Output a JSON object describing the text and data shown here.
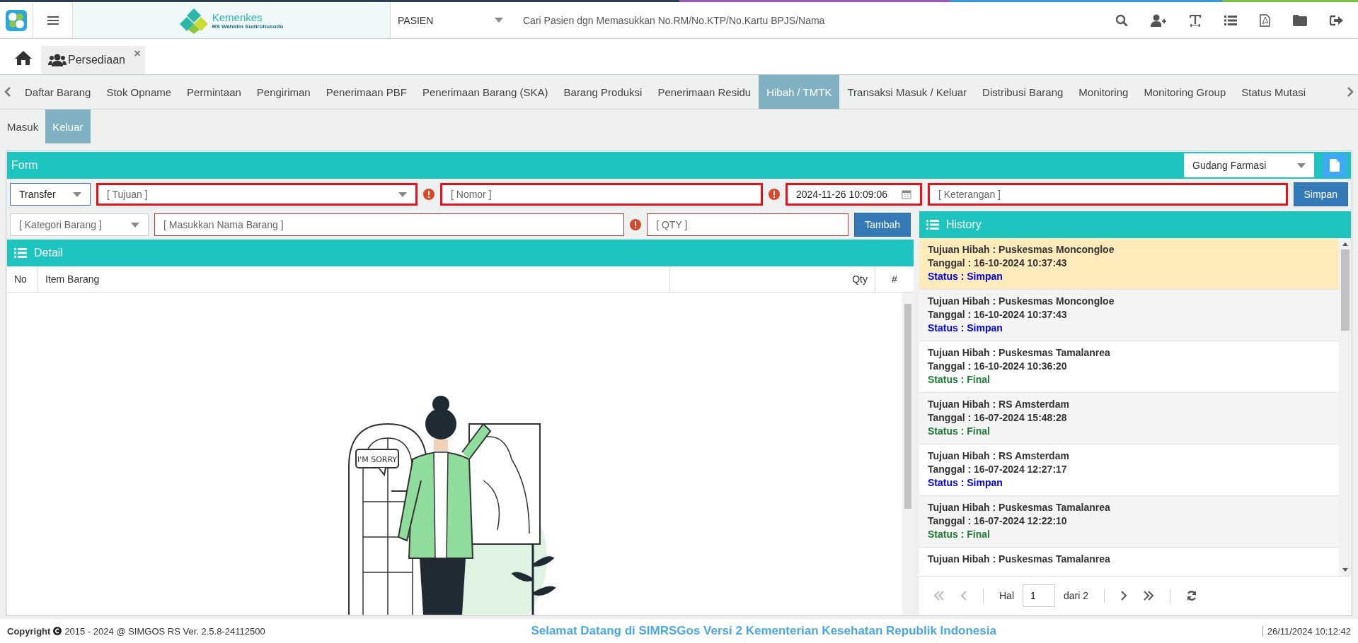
{
  "header": {
    "logo_title": "Kemenkes",
    "logo_subtitle": "RS Wahidin Sudirohusodo",
    "search_type": "PASIEN",
    "search_placeholder": "Cari Pasien dgn Memasukkan No.RM/No.KTP/No.Kartu BPJS/Nama"
  },
  "open_tab": {
    "label": "Persediaan",
    "close": "×"
  },
  "nav_tabs": [
    {
      "label": "Daftar Barang",
      "selected": false
    },
    {
      "label": "Stok Opname",
      "selected": false
    },
    {
      "label": "Permintaan",
      "selected": false
    },
    {
      "label": "Pengiriman",
      "selected": false
    },
    {
      "label": "Penerimaan PBF",
      "selected": false
    },
    {
      "label": "Penerimaan Barang (SKA)",
      "selected": false
    },
    {
      "label": "Barang Produksi",
      "selected": false
    },
    {
      "label": "Penerimaan Residu",
      "selected": false
    },
    {
      "label": "Hibah / TMTK",
      "selected": true
    },
    {
      "label": "Transaksi Masuk / Keluar",
      "selected": false
    },
    {
      "label": "Distribusi Barang",
      "selected": false
    },
    {
      "label": "Monitoring",
      "selected": false
    },
    {
      "label": "Monitoring Group",
      "selected": false
    },
    {
      "label": "Status Mutasi",
      "selected": false
    }
  ],
  "sub_tabs": [
    {
      "label": "Masuk",
      "selected": false
    },
    {
      "label": "Keluar",
      "selected": true
    }
  ],
  "form": {
    "title": "Form",
    "warehouse": "Gudang Farmasi",
    "row_1": [
      {
        "kind": "select",
        "value": "Transfer",
        "highlighted": false,
        "error_icon": false
      },
      {
        "kind": "select",
        "placeholder": "[ Tujuan ]",
        "highlighted": true,
        "error_icon": true
      },
      {
        "kind": "text",
        "placeholder": "[ Nomor ]",
        "highlighted": true,
        "error_icon": true
      },
      {
        "kind": "date",
        "value": "2024-11-26 10:09:06",
        "highlighted": true,
        "error_icon": false
      },
      {
        "kind": "text",
        "placeholder": "[ Keterangan ]",
        "highlighted": true,
        "error_icon": false
      }
    ],
    "save_button": "Simpan",
    "row_2": [
      {
        "kind": "select",
        "placeholder": "[ Kategori Barang ]",
        "invalid": false,
        "error_icon": false
      },
      {
        "kind": "text",
        "placeholder": "[ Masukkan Nama Barang ]",
        "invalid": true,
        "error_icon": true
      },
      {
        "kind": "text",
        "placeholder": "[ QTY ]",
        "invalid": true,
        "error_icon": false
      }
    ],
    "add_button": "Tambah"
  },
  "detail": {
    "title": "Detail",
    "columns": [
      "No",
      "Item Barang",
      "Qty",
      "#"
    ],
    "illustration_caption": "I'M SORRY"
  },
  "history": {
    "title": "History",
    "items": [
      {
        "destination": "Tujuan Hibah : Puskesmas Moncongloe",
        "date": "Tanggal : 16-10-2024 10:37:43",
        "status": "Status : Simpan",
        "color": "#0000ee",
        "selected": true
      },
      {
        "destination": "Tujuan Hibah : Puskesmas Moncongloe",
        "date": "Tanggal : 16-10-2024 10:37:43",
        "status": "Status : Simpan",
        "color": "#0000ee",
        "selected": false
      },
      {
        "destination": "Tujuan Hibah : Puskesmas Tamalanrea",
        "date": "Tanggal : 16-10-2024 10:36:20",
        "status": "Status : Final",
        "color": "#1e7b34",
        "selected": false
      },
      {
        "destination": "Tujuan Hibah : RS Amsterdam",
        "date": "Tanggal : 16-07-2024 15:48:28",
        "status": "Status : Final",
        "color": "#1e7b34",
        "selected": false
      },
      {
        "destination": "Tujuan Hibah : RS Amsterdam",
        "date": "Tanggal : 16-07-2024 12:27:17",
        "status": "Status : Simpan",
        "color": "#0000ee",
        "selected": false
      },
      {
        "destination": "Tujuan Hibah : Puskesmas Tamalanrea",
        "date": "Tanggal : 16-07-2024 12:22:10",
        "status": "Status : Final",
        "color": "#1e7b34",
        "selected": false
      },
      {
        "destination": "Tujuan Hibah : Puskesmas Tamalanrea",
        "selected": false
      }
    ],
    "pager": {
      "page_label": "Hal",
      "page": "1",
      "total": "dari 2"
    }
  },
  "footer": {
    "copyright_label": "Copyright",
    "copyright_text": "2015 - 2024 @ SIMGOS RS Ver. 2.5.8-24112500",
    "welcome": "Selamat Datang di SIMRSGos Versi 2 Kementerian Kesehatan Republik Indonesia",
    "datetime": "26/11/2024 10:12:42"
  }
}
